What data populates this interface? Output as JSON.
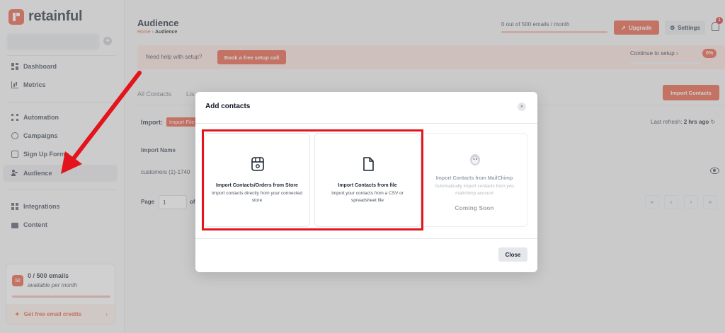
{
  "brand": {
    "name": "retainful"
  },
  "sidebar": {
    "add_store_glyph": "+",
    "items": [
      {
        "label": "Dashboard",
        "icon": "dashboard-icon"
      },
      {
        "label": "Metrics",
        "icon": "metrics-icon"
      },
      {
        "label": "Automation",
        "icon": "automation-icon"
      },
      {
        "label": "Campaigns",
        "icon": "campaigns-icon"
      },
      {
        "label": "Sign Up Forms",
        "icon": "signup-forms-icon"
      },
      {
        "label": "Audience",
        "icon": "audience-icon",
        "active": true
      },
      {
        "label": "Integrations",
        "icon": "integrations-icon"
      },
      {
        "label": "Content",
        "icon": "content-icon"
      }
    ],
    "credits": {
      "count": "0 / 500 emails",
      "period": "available per month",
      "link": "Get free email credits",
      "chevron": "›"
    }
  },
  "header": {
    "title": "Audience",
    "breadcrumb_home": "Home",
    "breadcrumb_sep": "›",
    "breadcrumb_current": "Audience",
    "quota_text": "0 out of 500 emails / month",
    "quota_used_fraction": 0,
    "upgrade_label": "Upgrade",
    "settings_label": "Settings",
    "notification_count": "1"
  },
  "banner": {
    "help_text": "Need help with setup?",
    "setup_button": "Book a free setup call",
    "continue_text": "Continue to setup",
    "continue_chevron": "›",
    "progress": "0%"
  },
  "content": {
    "tab_all": "All Contacts",
    "tab_lists": "Lis",
    "import_contacts_button": "Import Contacts",
    "import_label": "Import:",
    "import_badge": "Import File",
    "refresh_label": "Last refresh:",
    "refresh_value": "2 hrs ago",
    "column_import_name": "Import Name",
    "row_name": "customers (1)-1740",
    "page_label": "Page",
    "page_value": "1",
    "page_of": "of",
    "pager": [
      "«",
      "‹",
      "›",
      "»"
    ]
  },
  "modal": {
    "title": "Add contacts",
    "close_glyph": "×",
    "options": [
      {
        "title": "Import Contacts/Orders from Store",
        "desc": "Import contacts directly from your connected store",
        "icon": "store-icon",
        "enabled": true
      },
      {
        "title": "Import Contacts from file",
        "desc": "Import your contacts from a CSV or spreadsheet file",
        "icon": "file-icon",
        "enabled": true
      },
      {
        "title": "Import Contacts from MailChimp",
        "desc": "Automatically import contacts from you mailchimp account",
        "icon": "mailchimp-icon",
        "enabled": false,
        "status": "Coming Soon"
      }
    ],
    "close_button": "Close"
  },
  "annotations": {
    "highlight_color": "#e3141b",
    "arrow_color": "#e3141b"
  },
  "colors": {
    "accent": "#e8543a"
  }
}
